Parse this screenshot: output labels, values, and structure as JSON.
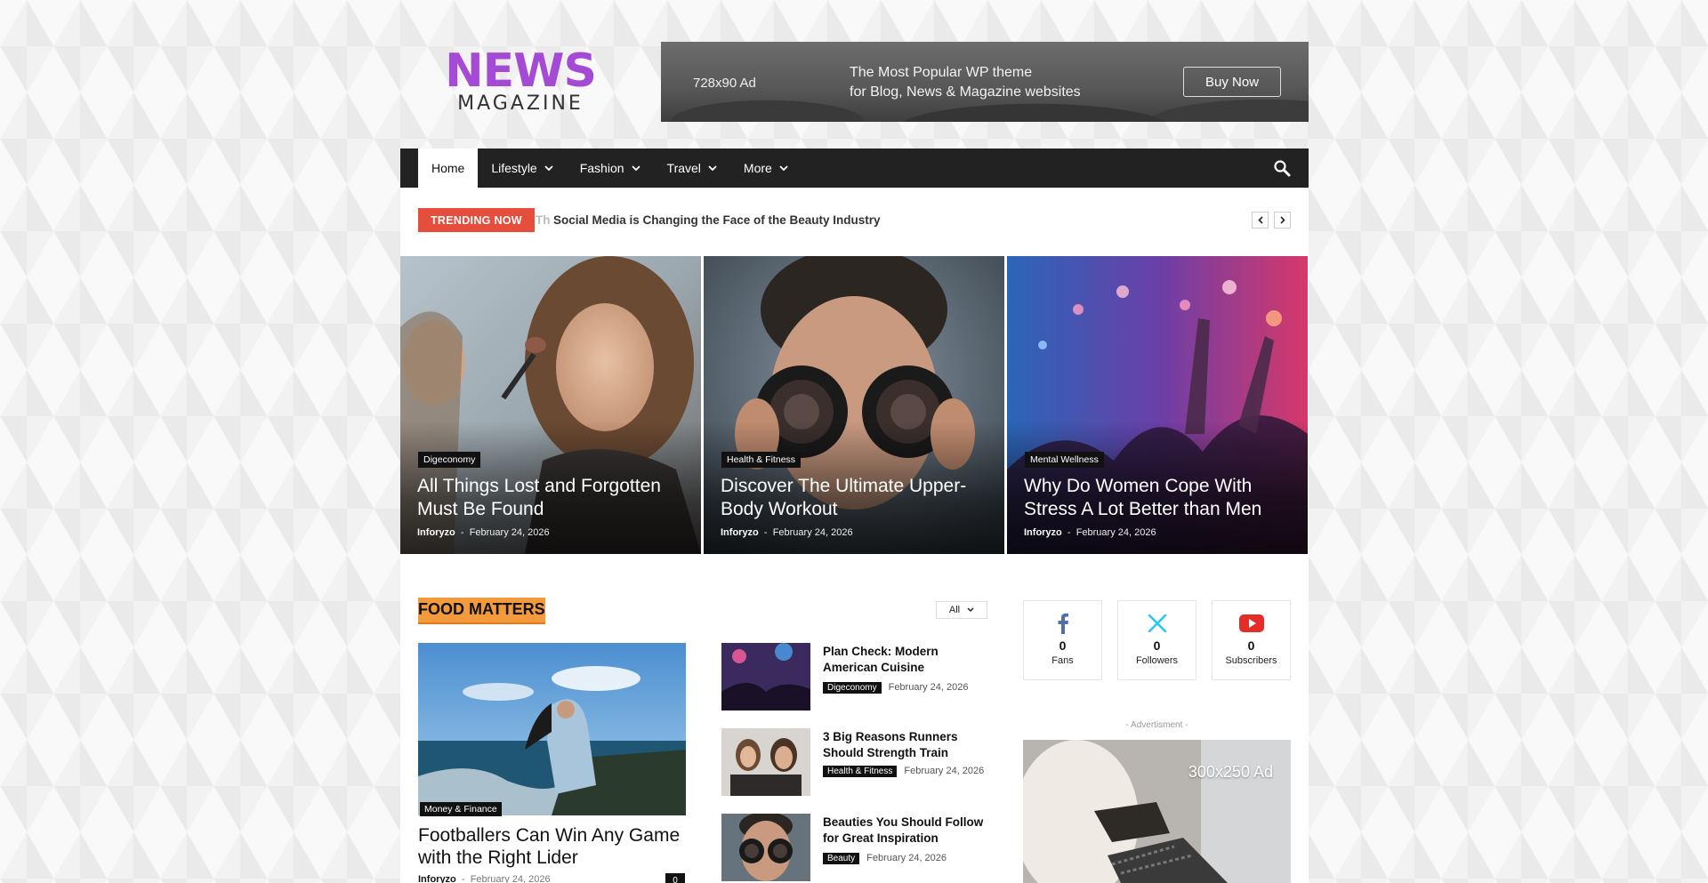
{
  "header": {
    "logo_top": "NEWS",
    "logo_bottom": "MAGAZINE",
    "ad": {
      "size_label": "728x90 Ad",
      "line1": "The Most Popular WP theme",
      "line2": "for Blog, News & Magazine websites",
      "button": "Buy Now"
    }
  },
  "nav": {
    "items": [
      {
        "label": "Home",
        "dropdown": false
      },
      {
        "label": "Lifestyle",
        "dropdown": true
      },
      {
        "label": "Fashion",
        "dropdown": true
      },
      {
        "label": "Travel",
        "dropdown": true
      },
      {
        "label": "More",
        "dropdown": true
      }
    ],
    "search_icon": "search-icon"
  },
  "trending": {
    "label": "TRENDING NOW",
    "fade_text": "Th",
    "headline": "Social Media is Changing the Face of the Beauty Industry",
    "prev_icon": "chevron-left-icon",
    "next_icon": "chevron-right-icon"
  },
  "hero": [
    {
      "category": "Digeconomy",
      "title": "All Things Lost and Forgotten Must Be Found",
      "author": "Inforyzo",
      "date": "February 24, 2026"
    },
    {
      "category": "Health & Fitness",
      "title": "Discover The Ultimate Upper-Body Workout",
      "author": "Inforyzo",
      "date": "February 24, 2026"
    },
    {
      "category": "Mental Wellness",
      "title": "Why Do Women Cope With Stress A Lot Better than Men",
      "author": "Inforyzo",
      "date": "February 24, 2026"
    }
  ],
  "section": {
    "title": "FOOD MATTERS",
    "filter": "All",
    "main": {
      "category": "Money & Finance",
      "title": "Footballers Can Win Any Game with the Right Lider",
      "author": "Inforyzo",
      "date": "February 24, 2026",
      "comments": "0"
    },
    "list": [
      {
        "title": "Plan Check: Modern American Cuisine",
        "category": "Digeconomy",
        "date": "February 24, 2026"
      },
      {
        "title": "3 Big Reasons Runners Should Strength Train",
        "category": "Health & Fitness",
        "date": "February 24, 2026"
      },
      {
        "title": "Beauties You Should Follow for Great Inspiration",
        "category": "Beauty",
        "date": "February 24, 2026"
      }
    ]
  },
  "social": [
    {
      "icon": "facebook-icon",
      "count": "0",
      "label": "Fans",
      "color": "#516eab"
    },
    {
      "icon": "x-twitter-icon",
      "count": "0",
      "label": "Followers",
      "color": "#29c5f6"
    },
    {
      "icon": "youtube-icon",
      "count": "0",
      "label": "Subscribers",
      "color": "#e52d27"
    }
  ],
  "sidebar_ad": {
    "label": "- Advertisment -",
    "size_label": "300x250 Ad"
  },
  "colors": {
    "accent_purple": "#a54ad5",
    "trending_red": "#e54e3d",
    "section_orange": "#f39a3d",
    "nav_dark": "#222222"
  }
}
